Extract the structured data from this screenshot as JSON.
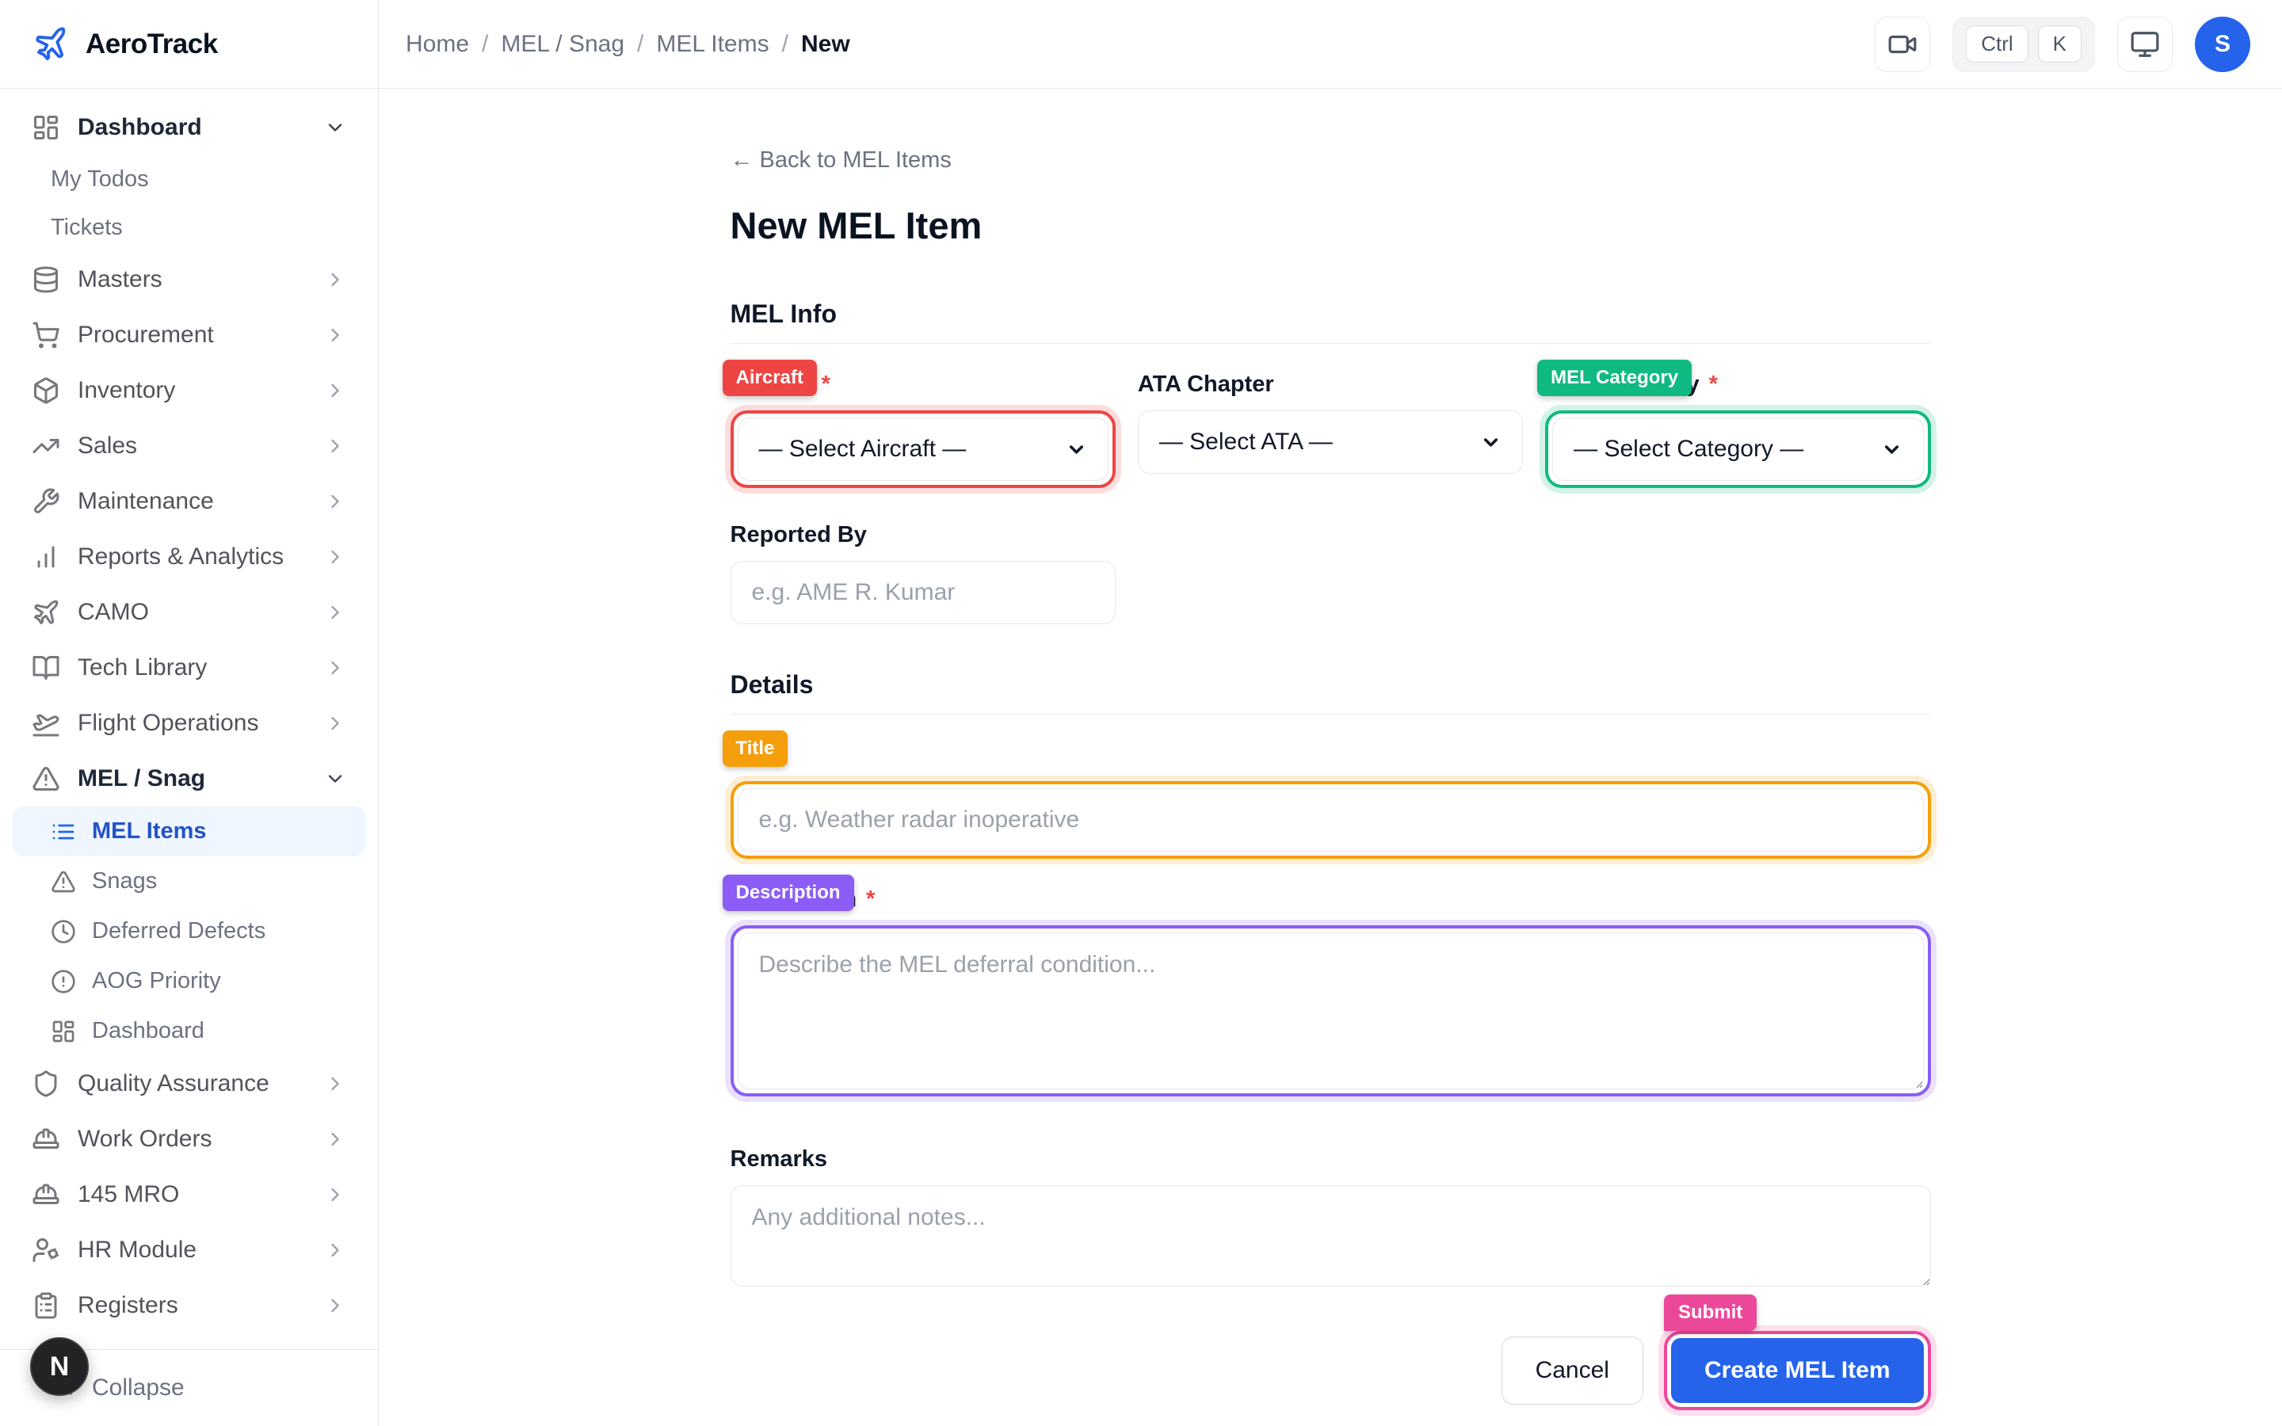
{
  "brand": {
    "name": "AeroTrack",
    "accent_color": "#2563eb"
  },
  "breadcrumb": {
    "separator": "/",
    "items": [
      {
        "label": "Home"
      },
      {
        "label": "MEL / Snag"
      },
      {
        "label": "MEL Items"
      },
      {
        "label": "New",
        "current": true
      }
    ]
  },
  "topbar": {
    "shortcut": {
      "keys": [
        "Ctrl",
        "K"
      ]
    },
    "avatar_initial": "S"
  },
  "sidebar": {
    "items": [
      {
        "label": "Dashboard",
        "icon": "layout-dashboard-icon",
        "kind": "top",
        "chevron": "down",
        "emphasis": true
      },
      {
        "label": "My Todos",
        "kind": "sub"
      },
      {
        "label": "Tickets",
        "kind": "sub"
      },
      {
        "label": "Masters",
        "icon": "database-icon",
        "kind": "top",
        "chevron": "right"
      },
      {
        "label": "Procurement",
        "icon": "cart-icon",
        "kind": "top",
        "chevron": "right"
      },
      {
        "label": "Inventory",
        "icon": "package-icon",
        "kind": "top",
        "chevron": "right"
      },
      {
        "label": "Sales",
        "icon": "trending-up-icon",
        "kind": "top",
        "chevron": "right"
      },
      {
        "label": "Maintenance",
        "icon": "wrench-icon",
        "kind": "top",
        "chevron": "right"
      },
      {
        "label": "Reports & Analytics",
        "icon": "bar-chart-icon",
        "kind": "top",
        "chevron": "right"
      },
      {
        "label": "CAMO",
        "icon": "plane-icon",
        "kind": "top",
        "chevron": "right"
      },
      {
        "label": "Tech Library",
        "icon": "book-open-icon",
        "kind": "top",
        "chevron": "right"
      },
      {
        "label": "Flight Operations",
        "icon": "plane-takeoff-icon",
        "kind": "top",
        "chevron": "right"
      },
      {
        "label": "MEL / Snag",
        "icon": "alert-triangle-icon",
        "kind": "top",
        "chevron": "down",
        "emphasis": true
      },
      {
        "label": "MEL Items",
        "icon": "list-icon",
        "kind": "subicon",
        "active": true
      },
      {
        "label": "Snags",
        "icon": "alert-triangle-icon",
        "kind": "subicon"
      },
      {
        "label": "Deferred Defects",
        "icon": "clock-icon",
        "kind": "subicon"
      },
      {
        "label": "AOG Priority",
        "icon": "alert-circle-icon",
        "kind": "subicon"
      },
      {
        "label": "Dashboard",
        "icon": "layout-dashboard-icon",
        "kind": "subicon"
      },
      {
        "label": "Quality Assurance",
        "icon": "shield-icon",
        "kind": "top",
        "chevron": "right"
      },
      {
        "label": "Work Orders",
        "icon": "hard-hat-icon",
        "kind": "top",
        "chevron": "right"
      },
      {
        "label": "145 MRO",
        "icon": "hard-hat-icon",
        "kind": "top",
        "chevron": "right"
      },
      {
        "label": "HR Module",
        "icon": "user-cog-icon",
        "kind": "top",
        "chevron": "right"
      },
      {
        "label": "Registers",
        "icon": "clipboard-list-icon",
        "kind": "top",
        "chevron": "right"
      }
    ],
    "collapse_label": "Collapse",
    "floating_avatar_initial": "N"
  },
  "page": {
    "back_link": "← Back to MEL Items",
    "title": "New MEL Item"
  },
  "form": {
    "mel_info_heading": "MEL Info",
    "details_heading": "Details",
    "fields": {
      "aircraft": {
        "badge": "Aircraft",
        "required": "*",
        "select_value": "— Select Aircraft —",
        "color": "#ef4444"
      },
      "ata": {
        "label": "ATA Chapter",
        "select_value": "— Select ATA —"
      },
      "category": {
        "badge": "MEL Category",
        "required": "*",
        "select_value": "— Select Category —",
        "color": "#10b981"
      },
      "reported_by": {
        "label": "Reported By",
        "placeholder": "e.g. AME R. Kumar"
      },
      "title": {
        "badge": "Title",
        "placeholder": "e.g. Weather radar inoperative",
        "color": "#f59e0b"
      },
      "description": {
        "badge": "Description",
        "required": "*",
        "placeholder": "Describe the MEL deferral condition...",
        "color": "#8b5cf6"
      },
      "remarks": {
        "label": "Remarks",
        "placeholder": "Any additional notes..."
      }
    },
    "actions": {
      "cancel": "Cancel",
      "submit": "Create MEL Item",
      "submit_badge": "Submit",
      "submit_badge_color": "#ec4899",
      "submit_button_color": "#2563eb"
    }
  }
}
